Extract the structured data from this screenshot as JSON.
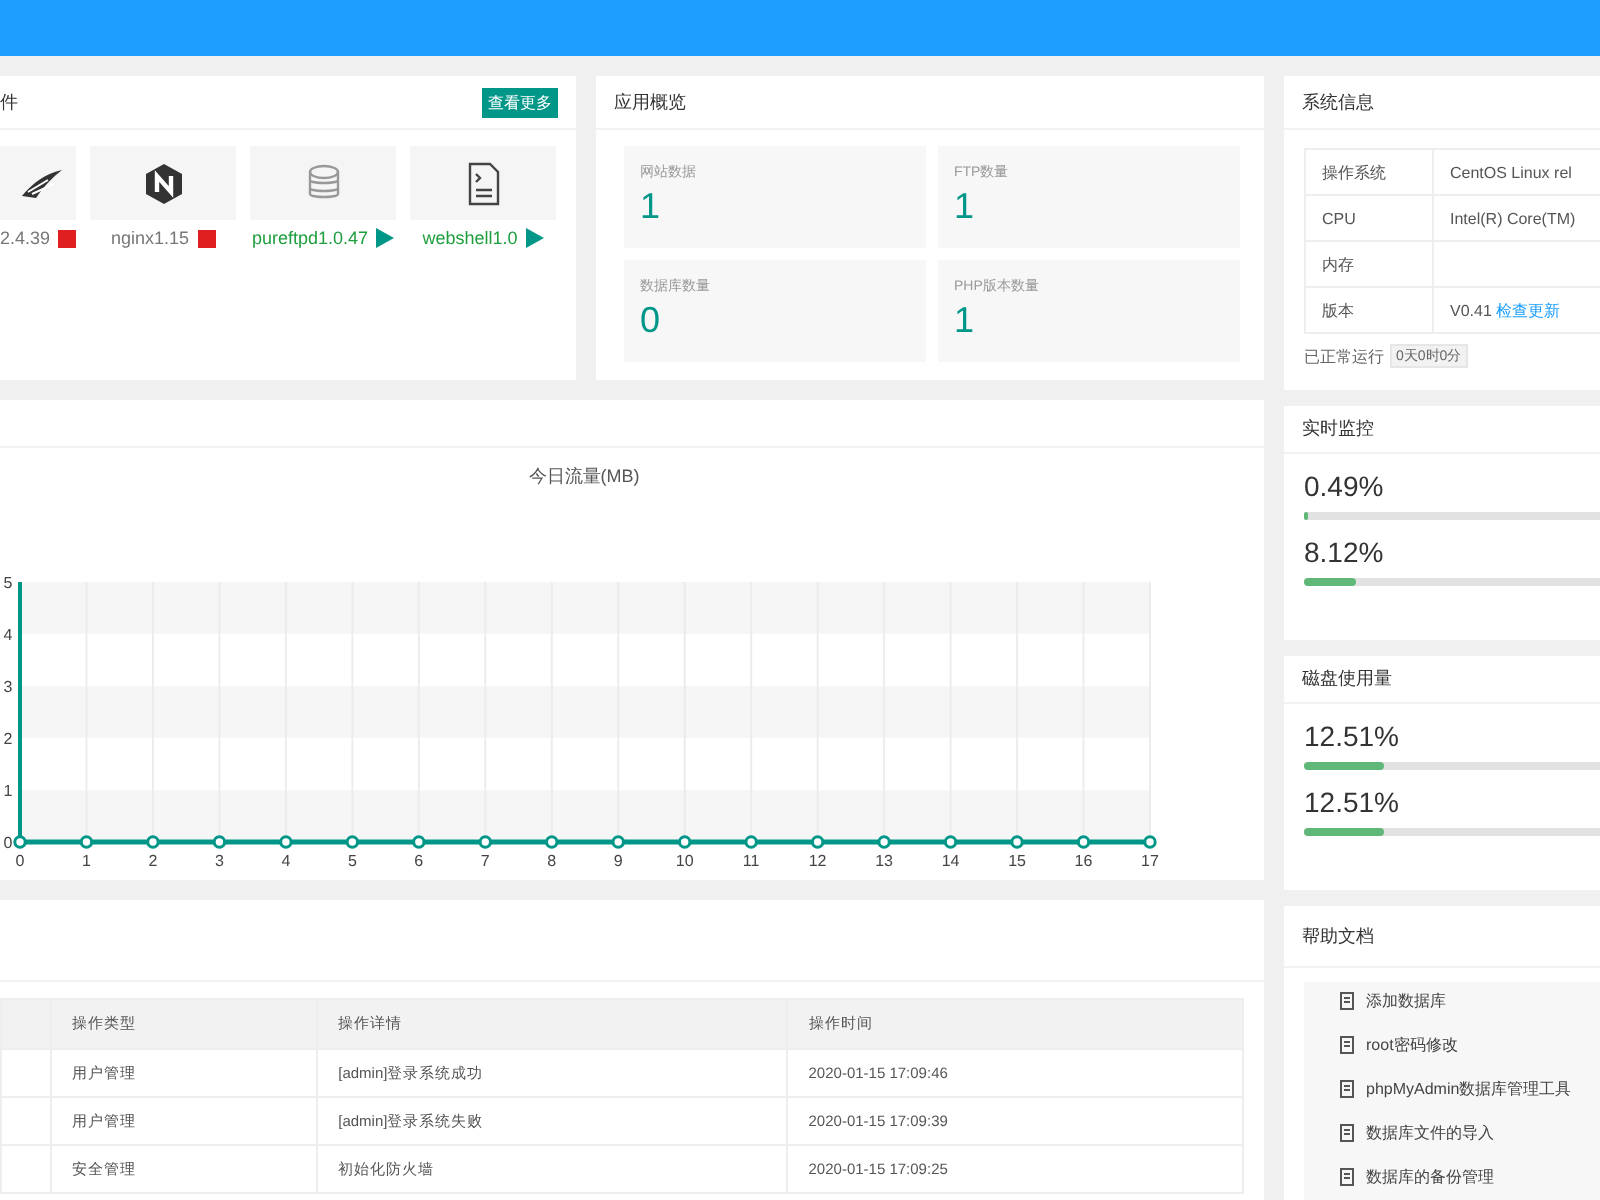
{
  "software": {
    "title": "件",
    "more_button": "查看更多",
    "items": [
      {
        "name": "2.4.39",
        "kind": "feather",
        "running": true
      },
      {
        "name": "nginx1.15",
        "kind": "hexagon",
        "running": true
      },
      {
        "name": "pureftpd1.0.47",
        "kind": "database",
        "running": false
      },
      {
        "name": "webshell1.0",
        "kind": "shell",
        "running": false
      }
    ]
  },
  "app_overview": {
    "title": "应用概览",
    "stats": [
      {
        "label": "网站数据",
        "value": "1"
      },
      {
        "label": "FTP数量",
        "value": "1"
      },
      {
        "label": "数据库数量",
        "value": "0"
      },
      {
        "label": "PHP版本数量",
        "value": "1"
      }
    ]
  },
  "system_info": {
    "title": "系统信息",
    "rows": [
      {
        "label": "操作系统",
        "value": "CentOS Linux rel"
      },
      {
        "label": "CPU",
        "value": "Intel(R) Core(TM)"
      },
      {
        "label": "内存"
      },
      {
        "label": "版本",
        "value": "V0.41",
        "link": "检查更新"
      }
    ],
    "uptime_label": "已正常运行",
    "uptime": "0天0时0分"
  },
  "traffic": {
    "chart_data": {
      "type": "line",
      "title": "今日流量(MB)",
      "x": [
        0,
        1,
        2,
        3,
        4,
        5,
        6,
        7,
        8,
        9,
        10,
        11,
        12,
        13,
        14,
        15,
        16,
        17
      ],
      "series": [
        {
          "color": "#009688",
          "marker": "circle",
          "values": [
            0,
            0,
            0,
            0,
            0,
            0,
            0,
            0,
            0,
            0,
            0,
            0,
            0,
            0,
            0,
            0,
            0,
            0
          ]
        }
      ],
      "xlim": [
        0,
        17
      ],
      "ylim": [
        0,
        5
      ],
      "grid": true,
      "yticks": [
        0,
        1,
        2,
        3,
        4,
        5
      ],
      "xticks": [
        0,
        1,
        2,
        3,
        4,
        5,
        6,
        7,
        8,
        9,
        10,
        11,
        12,
        13,
        14,
        15,
        16,
        17
      ]
    }
  },
  "realtime": {
    "title": "实时监控",
    "meters": [
      {
        "reading": "0.49%",
        "level": 0.0049
      },
      {
        "reading": "8.12%",
        "level": 0.0812
      }
    ]
  },
  "disk": {
    "title": "磁盘使用量",
    "meters": [
      {
        "reading": "12.51%",
        "level": 0.1251
      },
      {
        "reading": "12.51%",
        "level": 0.1251
      }
    ]
  },
  "log": {
    "columns": [
      "操作类型",
      "操作详情",
      "操作时间"
    ],
    "rows": [
      [
        "用户管理",
        "[admin]登录系统成功",
        "2020-01-15 17:09:46"
      ],
      [
        "用户管理",
        "[admin]登录系统失败",
        "2020-01-15 17:09:39"
      ],
      [
        "安全管理",
        "初始化防火墙",
        "2020-01-15 17:09:25"
      ]
    ]
  },
  "help": {
    "title": "帮助文档",
    "items": [
      "添加数据库",
      "root密码修改",
      "phpMyAdmin数据库管理工具",
      "数据库文件的导入",
      "数据库的备份管理"
    ]
  }
}
